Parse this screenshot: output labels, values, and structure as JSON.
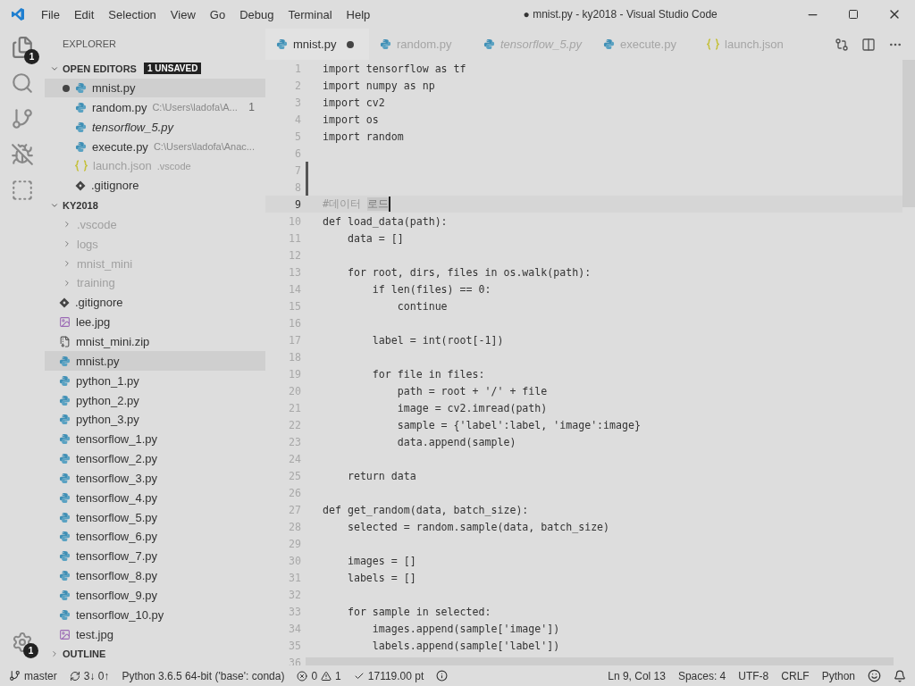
{
  "title_bar": {
    "menu": [
      "File",
      "Edit",
      "Selection",
      "View",
      "Go",
      "Debug",
      "Terminal",
      "Help"
    ],
    "title": "● mnist.py - ky2018 - Visual Studio Code"
  },
  "activity_bar": {
    "explorer_badge": "1",
    "settings_badge": "1"
  },
  "sidebar": {
    "title": "EXPLORER",
    "open_editors": {
      "label": "OPEN EDITORS",
      "expanded": true,
      "badge": "1 UNSAVED",
      "items": [
        {
          "name": "mnist.py",
          "kind": "python",
          "dirty": true,
          "selected": true,
          "italic": false,
          "dimmed": false
        },
        {
          "name": "random.py",
          "kind": "python",
          "detail": "C:\\Users\\ladofa\\A...",
          "problems": "1",
          "dirty": false,
          "selected": false,
          "italic": false,
          "dimmed": false
        },
        {
          "name": "tensorflow_5.py",
          "kind": "python",
          "dirty": false,
          "selected": false,
          "italic": true,
          "dimmed": false
        },
        {
          "name": "execute.py",
          "kind": "python",
          "detail": "C:\\Users\\ladofa\\Anac...",
          "dirty": false,
          "selected": false,
          "italic": false,
          "dimmed": false
        },
        {
          "name": "launch.json",
          "kind": "json",
          "detail": ".vscode",
          "dirty": false,
          "selected": false,
          "italic": false,
          "dimmed": true
        },
        {
          "name": ".gitignore",
          "kind": "git",
          "dirty": false,
          "selected": false,
          "italic": false,
          "dimmed": false
        }
      ]
    },
    "folder": {
      "label": "KY2018",
      "expanded": true,
      "items": [
        {
          "name": ".vscode",
          "kind": "folder",
          "expanded": false,
          "dimmed": true,
          "selected": false
        },
        {
          "name": "logs",
          "kind": "folder",
          "expanded": false,
          "dimmed": true,
          "selected": false
        },
        {
          "name": "mnist_mini",
          "kind": "folder",
          "expanded": false,
          "dimmed": true,
          "selected": false
        },
        {
          "name": "training",
          "kind": "folder",
          "expanded": false,
          "dimmed": true,
          "selected": false
        },
        {
          "name": ".gitignore",
          "kind": "git",
          "dimmed": false,
          "selected": false
        },
        {
          "name": "lee.jpg",
          "kind": "image",
          "dimmed": false,
          "selected": false
        },
        {
          "name": "mnist_mini.zip",
          "kind": "zip",
          "dimmed": false,
          "selected": false
        },
        {
          "name": "mnist.py",
          "kind": "python",
          "dimmed": false,
          "selected": true
        },
        {
          "name": "python_1.py",
          "kind": "python",
          "dimmed": false,
          "selected": false
        },
        {
          "name": "python_2.py",
          "kind": "python",
          "dimmed": false,
          "selected": false
        },
        {
          "name": "python_3.py",
          "kind": "python",
          "dimmed": false,
          "selected": false
        },
        {
          "name": "tensorflow_1.py",
          "kind": "python",
          "dimmed": false,
          "selected": false
        },
        {
          "name": "tensorflow_2.py",
          "kind": "python",
          "dimmed": false,
          "selected": false
        },
        {
          "name": "tensorflow_3.py",
          "kind": "python",
          "dimmed": false,
          "selected": false
        },
        {
          "name": "tensorflow_4.py",
          "kind": "python",
          "dimmed": false,
          "selected": false
        },
        {
          "name": "tensorflow_5.py",
          "kind": "python",
          "dimmed": false,
          "selected": false
        },
        {
          "name": "tensorflow_6.py",
          "kind": "python",
          "dimmed": false,
          "selected": false
        },
        {
          "name": "tensorflow_7.py",
          "kind": "python",
          "dimmed": false,
          "selected": false
        },
        {
          "name": "tensorflow_8.py",
          "kind": "python",
          "dimmed": false,
          "selected": false
        },
        {
          "name": "tensorflow_9.py",
          "kind": "python",
          "dimmed": false,
          "selected": false
        },
        {
          "name": "tensorflow_10.py",
          "kind": "python",
          "dimmed": false,
          "selected": false
        },
        {
          "name": "test.jpg",
          "kind": "image",
          "dimmed": false,
          "selected": false
        }
      ]
    },
    "outline": {
      "label": "OUTLINE",
      "expanded": false
    }
  },
  "tabs": [
    {
      "label": "mnist.py",
      "kind": "python",
      "selected": true,
      "dirty": true,
      "italic": false
    },
    {
      "label": "random.py",
      "kind": "python",
      "selected": false,
      "dirty": false,
      "italic": false
    },
    {
      "label": "tensorflow_5.py",
      "kind": "python",
      "selected": false,
      "dirty": false,
      "italic": true
    },
    {
      "label": "execute.py",
      "kind": "python",
      "selected": false,
      "dirty": false,
      "italic": false
    },
    {
      "label": "launch.json",
      "kind": "json",
      "selected": false,
      "dirty": false,
      "italic": false
    }
  ],
  "editor": {
    "lines": [
      {
        "n": "1",
        "changed": false,
        "current": false,
        "code": "import tensorflow as tf"
      },
      {
        "n": "2",
        "changed": false,
        "current": false,
        "code": "import numpy as np"
      },
      {
        "n": "3",
        "changed": false,
        "current": false,
        "code": "import cv2"
      },
      {
        "n": "4",
        "changed": false,
        "current": false,
        "code": "import os"
      },
      {
        "n": "5",
        "changed": false,
        "current": false,
        "code": "import random"
      },
      {
        "n": "6",
        "changed": false,
        "current": false
      },
      {
        "n": "7",
        "changed": true,
        "current": false
      },
      {
        "n": "8",
        "changed": true,
        "current": false
      },
      {
        "n": "9",
        "changed": false,
        "current": true,
        "code": "#데이터 ",
        "selection": "로드"
      },
      {
        "n": "10",
        "changed": false,
        "current": false,
        "code": "def load_data(path):"
      },
      {
        "n": "11",
        "changed": false,
        "current": false,
        "code": "    data = []"
      },
      {
        "n": "12",
        "changed": false,
        "current": false
      },
      {
        "n": "13",
        "changed": false,
        "current": false,
        "code": "    for root, dirs, files in os.walk(path):"
      },
      {
        "n": "14",
        "changed": false,
        "current": false,
        "code": "        if len(files) == 0:"
      },
      {
        "n": "15",
        "changed": false,
        "current": false,
        "code": "            continue"
      },
      {
        "n": "16",
        "changed": false,
        "current": false
      },
      {
        "n": "17",
        "changed": false,
        "current": false,
        "code": "        label = int(root[-1])"
      },
      {
        "n": "18",
        "changed": false,
        "current": false
      },
      {
        "n": "19",
        "changed": false,
        "current": false,
        "code": "        for file in files:"
      },
      {
        "n": "20",
        "changed": false,
        "current": false,
        "code": "            path = root + '/' + file"
      },
      {
        "n": "21",
        "changed": false,
        "current": false,
        "code": "            image = cv2.imread(path)"
      },
      {
        "n": "22",
        "changed": false,
        "current": false,
        "code": "            sample = {'label':label, 'image':image}"
      },
      {
        "n": "23",
        "changed": false,
        "current": false,
        "code": "            data.append(sample)"
      },
      {
        "n": "24",
        "changed": false,
        "current": false
      },
      {
        "n": "25",
        "changed": false,
        "current": false,
        "code": "    return data"
      },
      {
        "n": "26",
        "changed": false,
        "current": false
      },
      {
        "n": "27",
        "changed": false,
        "current": false,
        "code": "def get_random(data, batch_size):"
      },
      {
        "n": "28",
        "changed": false,
        "current": false,
        "code": "    selected = random.sample(data, batch_size)"
      },
      {
        "n": "29",
        "changed": false,
        "current": false
      },
      {
        "n": "30",
        "changed": false,
        "current": false,
        "code": "    images = []"
      },
      {
        "n": "31",
        "changed": false,
        "current": false,
        "code": "    labels = []"
      },
      {
        "n": "32",
        "changed": false,
        "current": false
      },
      {
        "n": "33",
        "changed": false,
        "current": false,
        "code": "    for sample in selected:"
      },
      {
        "n": "34",
        "changed": false,
        "current": false,
        "code": "        images.append(sample['image'])"
      },
      {
        "n": "35",
        "changed": false,
        "current": false,
        "code": "        labels.append(sample['label'])"
      },
      {
        "n": "36",
        "changed": false,
        "current": false
      }
    ]
  },
  "status_bar": {
    "branch": "master",
    "sync": "3↓ 0↑",
    "interpreter": "Python 3.6.5 64-bit ('base': conda)",
    "errors": "0",
    "warnings": "1",
    "measure": "17119.00 pt",
    "right": [
      "Ln 9, Col 13",
      "Spaces: 4",
      "UTF-8",
      "CRLF",
      "Python"
    ]
  }
}
